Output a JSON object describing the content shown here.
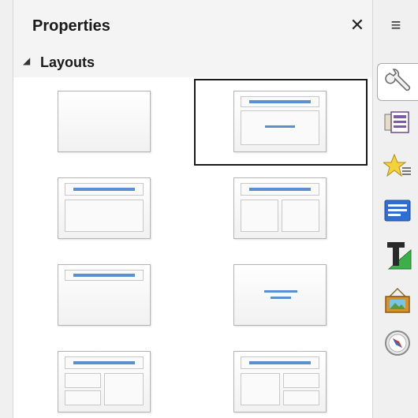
{
  "panel": {
    "title": "Properties",
    "close_label": "✕",
    "section": {
      "label": "Layouts",
      "expanded_glyph": "◢"
    },
    "layouts": [
      {
        "name": "blank-slide"
      },
      {
        "name": "title-content",
        "selected": true
      },
      {
        "name": "title-content-2"
      },
      {
        "name": "title-two-content"
      },
      {
        "name": "title-only"
      },
      {
        "name": "centered-text"
      },
      {
        "name": "title-two-content-and-content"
      },
      {
        "name": "title-content-and-two-content"
      }
    ]
  },
  "sidebar": {
    "menu_glyph": "≡",
    "icons": [
      "wrench-icon",
      "slide-transition-icon",
      "animation-star-icon",
      "master-slides-icon",
      "styles-text-icon",
      "gallery-icon",
      "navigator-compass-icon"
    ]
  },
  "colors": {
    "accent_bar": "#5b8fd0",
    "selection": "#1a1a1a"
  }
}
